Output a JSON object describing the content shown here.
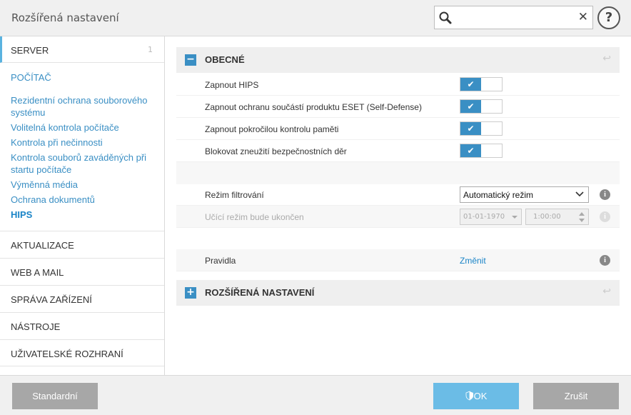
{
  "window": {
    "title": "Rozšířená nastavení"
  },
  "search": {
    "placeholder": "",
    "clear": "✕"
  },
  "help": {
    "label": "?"
  },
  "sidebar": {
    "server": {
      "label": "SERVER",
      "count": "1"
    },
    "computer": {
      "label": "POČÍTAČ"
    },
    "items": [
      {
        "label": "Rezidentní ochrana souborového systému"
      },
      {
        "label": "Volitelná kontrola počítače"
      },
      {
        "label": "Kontrola při nečinnosti"
      },
      {
        "label": "Kontrola souborů zaváděných při startu počítače"
      },
      {
        "label": "Výměnná média"
      },
      {
        "label": "Ochrana dokumentů"
      },
      {
        "label": "HIPS"
      }
    ],
    "sections": [
      {
        "label": "AKTUALIZACE"
      },
      {
        "label": "WEB A MAIL"
      },
      {
        "label": "SPRÁVA ZAŘÍZENÍ"
      },
      {
        "label": "NÁSTROJE"
      },
      {
        "label": "UŽIVATELSKÉ ROZHRANÍ"
      }
    ]
  },
  "main": {
    "general": {
      "title": "OBECNÉ",
      "toggle": "−",
      "toggles": [
        {
          "label": "Zapnout HIPS",
          "on": "✔"
        },
        {
          "label": "Zapnout ochranu součástí produktu ESET (Self-Defense)",
          "on": "✔"
        },
        {
          "label": "Zapnout pokročilou kontrolu paměti",
          "on": "✔"
        },
        {
          "label": "Blokovat zneužití bezpečnostních děr",
          "on": "✔"
        }
      ],
      "filter_mode": {
        "label": "Režim filtrování",
        "value": "Automatický režim"
      },
      "learning": {
        "label": "Učící režim bude ukončen",
        "date": "01-01-1970",
        "time": "1:00:00"
      },
      "rules": {
        "label": "Pravidla",
        "link": "Změnit"
      }
    },
    "advanced": {
      "title": "ROZŠÍŘENÁ NASTAVENÍ",
      "toggle": "+"
    }
  },
  "footer": {
    "default": "Standardní",
    "ok": "OK",
    "cancel": "Zrušit"
  },
  "colors": {
    "accent": "#3a8fc4",
    "button_gray": "#a7a7a7",
    "button_ok": "#6bbce6"
  }
}
